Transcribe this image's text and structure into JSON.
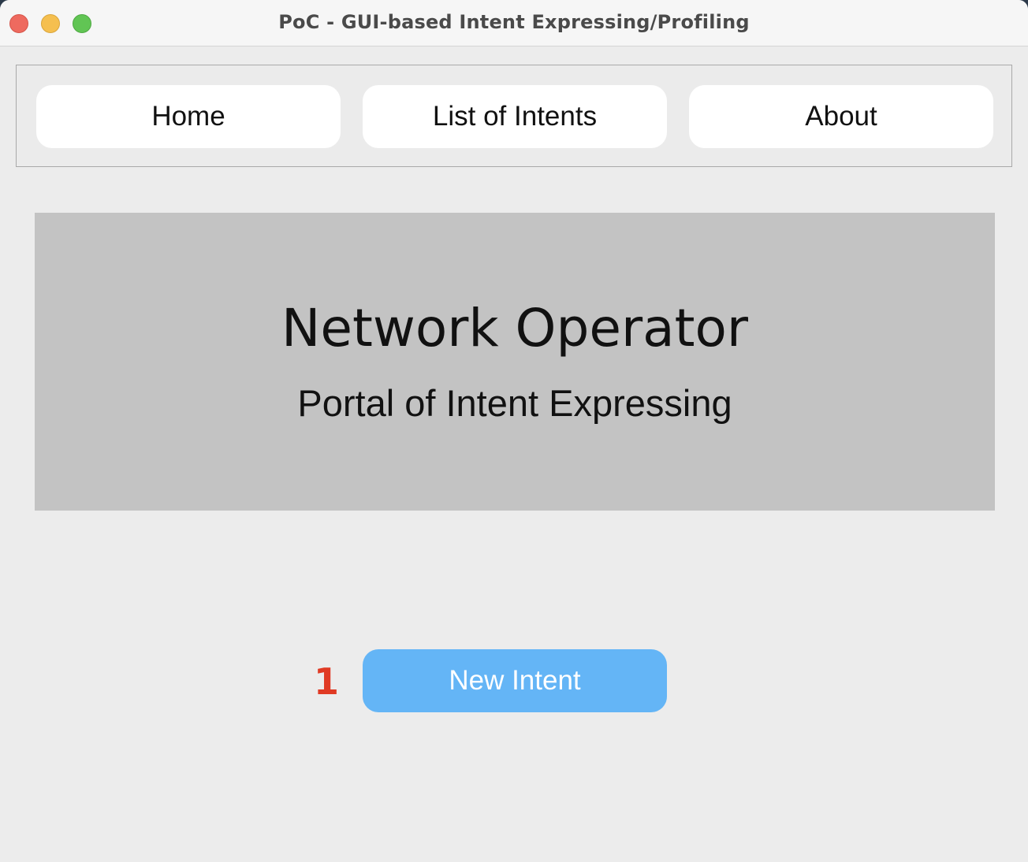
{
  "window": {
    "title": "PoC - GUI-based Intent Expressing/Profiling"
  },
  "nav": {
    "home_label": "Home",
    "list_label": "List of Intents",
    "about_label": "About"
  },
  "banner": {
    "title": "Network Operator",
    "subtitle": "Portal of Intent Expressing"
  },
  "actions": {
    "annotation": "1",
    "new_intent_label": "New Intent"
  },
  "colors": {
    "primary_button": "#64b5f6",
    "annotation": "#e03a24",
    "banner_bg": "#c3c3c3"
  }
}
